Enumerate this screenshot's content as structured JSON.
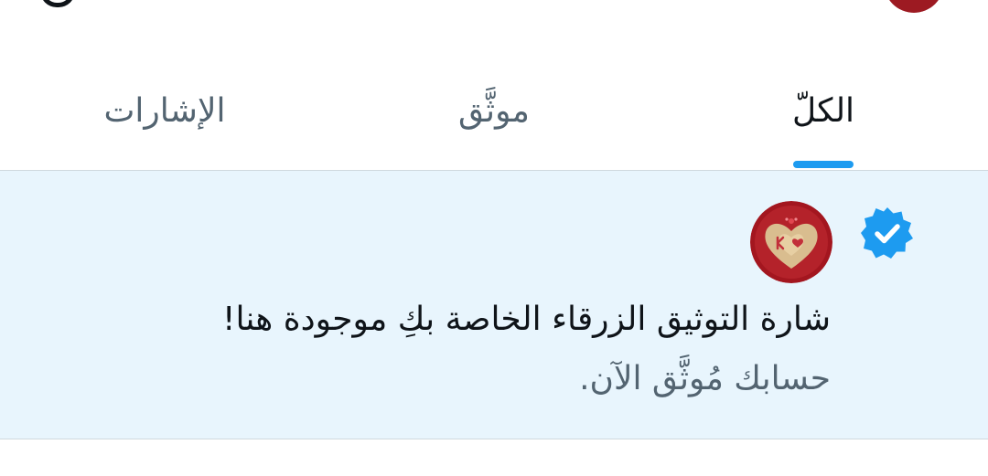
{
  "tabs": [
    {
      "label": "الكلّ",
      "active": true
    },
    {
      "label": "موثَّق",
      "active": false
    },
    {
      "label": "الإشارات",
      "active": false
    }
  ],
  "notification": {
    "title": "شارة التوثيق الزرقاء الخاصة بكِ موجودة هنا!",
    "body": "حسابك مُوثَّق الآن.",
    "icon": "verified-badge-icon"
  },
  "colors": {
    "accent": "#1d9bf0",
    "highlight_bg": "#e8f5fd",
    "text_primary": "#0f1419",
    "text_secondary": "#536471",
    "divider": "#cfd9de"
  }
}
